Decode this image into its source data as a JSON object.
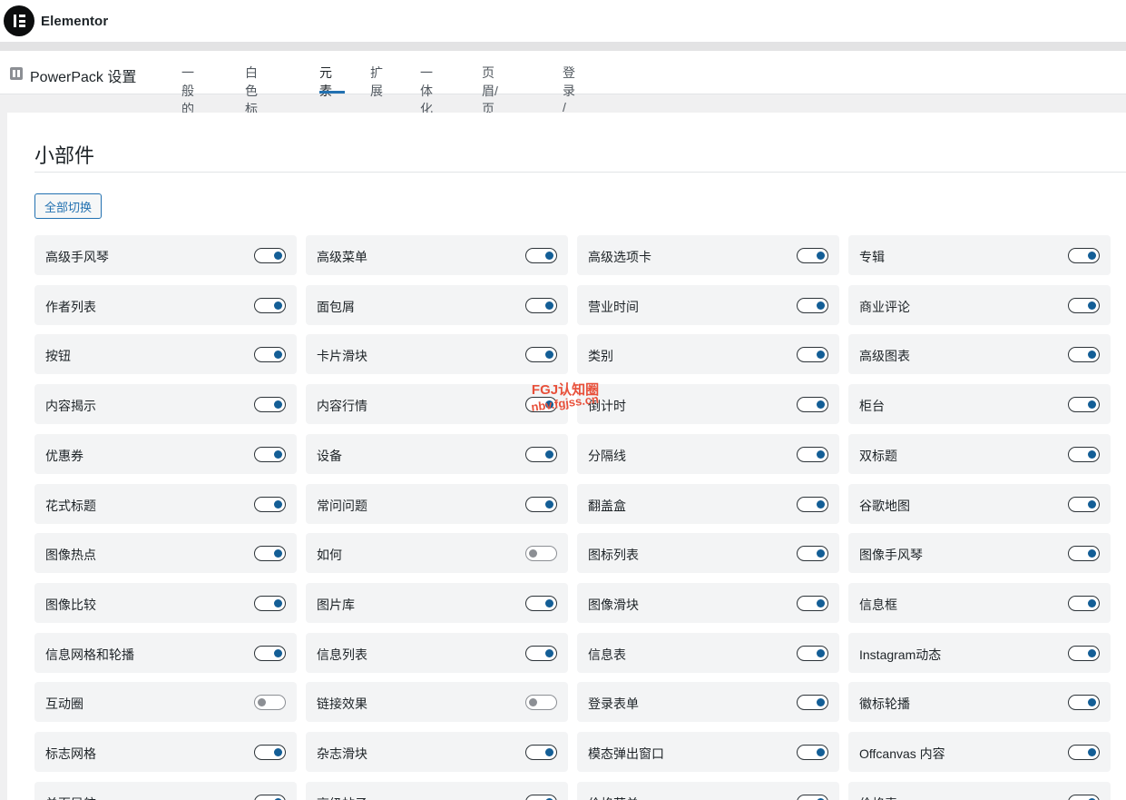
{
  "app": {
    "brand": "Elementor"
  },
  "nav": {
    "title": "PowerPack 设置",
    "tabs": [
      {
        "label": "一般的",
        "active": false
      },
      {
        "label": "白色标签",
        "active": false
      },
      {
        "label": "元素",
        "active": true
      },
      {
        "label": "扩展",
        "active": false
      },
      {
        "label": "一体化",
        "active": false
      },
      {
        "label": "页眉/页脚",
        "active": false
      },
      {
        "label": "登录 / 注册",
        "active": false
      }
    ]
  },
  "section": {
    "title": "小部件",
    "toggle_all_label": "全部切换"
  },
  "widgets": [
    {
      "label": "高级手风琴",
      "enabled": true
    },
    {
      "label": "高级菜单",
      "enabled": true
    },
    {
      "label": "高级选项卡",
      "enabled": true
    },
    {
      "label": "专辑",
      "enabled": true
    },
    {
      "label": "作者列表",
      "enabled": true
    },
    {
      "label": "面包屑",
      "enabled": true
    },
    {
      "label": "营业时间",
      "enabled": true
    },
    {
      "label": "商业评论",
      "enabled": true
    },
    {
      "label": "按钮",
      "enabled": true
    },
    {
      "label": "卡片滑块",
      "enabled": true
    },
    {
      "label": "类别",
      "enabled": true
    },
    {
      "label": "高级图表",
      "enabled": true
    },
    {
      "label": "内容揭示",
      "enabled": true
    },
    {
      "label": "内容行情",
      "enabled": true
    },
    {
      "label": "倒计时",
      "enabled": true
    },
    {
      "label": "柜台",
      "enabled": true
    },
    {
      "label": "优惠券",
      "enabled": true
    },
    {
      "label": "设备",
      "enabled": true
    },
    {
      "label": "分隔线",
      "enabled": true
    },
    {
      "label": "双标题",
      "enabled": true
    },
    {
      "label": "花式标题",
      "enabled": true
    },
    {
      "label": "常问问题",
      "enabled": true
    },
    {
      "label": "翻盖盒",
      "enabled": true
    },
    {
      "label": "谷歌地图",
      "enabled": true
    },
    {
      "label": "图像热点",
      "enabled": true
    },
    {
      "label": "如何",
      "enabled": false
    },
    {
      "label": "图标列表",
      "enabled": true
    },
    {
      "label": "图像手风琴",
      "enabled": true
    },
    {
      "label": "图像比较",
      "enabled": true
    },
    {
      "label": "图片库",
      "enabled": true
    },
    {
      "label": "图像滑块",
      "enabled": true
    },
    {
      "label": "信息框",
      "enabled": true
    },
    {
      "label": "信息网格和轮播",
      "enabled": true
    },
    {
      "label": "信息列表",
      "enabled": true
    },
    {
      "label": "信息表",
      "enabled": true
    },
    {
      "label": "Instagram动态",
      "enabled": true
    },
    {
      "label": "互动圈",
      "enabled": false
    },
    {
      "label": "链接效果",
      "enabled": false
    },
    {
      "label": "登录表单",
      "enabled": true
    },
    {
      "label": "徽标轮播",
      "enabled": true
    },
    {
      "label": "标志网格",
      "enabled": true
    },
    {
      "label": "杂志滑块",
      "enabled": true
    },
    {
      "label": "模态弹出窗口",
      "enabled": true
    },
    {
      "label": "Offcanvas 内容",
      "enabled": true
    },
    {
      "label": "单页导航",
      "enabled": true
    },
    {
      "label": "高级帖子",
      "enabled": true
    },
    {
      "label": "价格菜单",
      "enabled": true
    },
    {
      "label": "价格表",
      "enabled": true
    }
  ],
  "watermark": {
    "line1": "FGJ认知圈",
    "line2": "nbv.fgjss.cn"
  },
  "colors": {
    "accent": "#2271b1",
    "toggle_on": "#135e96",
    "toggle_off": "#8c8f94",
    "watermark": "#e8503a"
  }
}
